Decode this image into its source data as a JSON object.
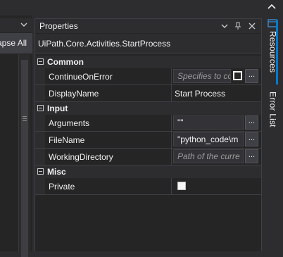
{
  "left_panel": {
    "toolbar_text": "apse All"
  },
  "properties": {
    "title": "Properties",
    "activity_name": "UiPath.Core.Activities.StartProcess",
    "categories": [
      {
        "name": "Common",
        "properties": [
          {
            "name": "ContinueOnError",
            "placeholder": "Specifies to co",
            "has_square": true,
            "has_ellipsis": true
          },
          {
            "name": "DisplayName",
            "value": "Start Process"
          }
        ]
      },
      {
        "name": "Input",
        "properties": [
          {
            "name": "Arguments",
            "value": "\"\"",
            "has_ellipsis": true
          },
          {
            "name": "FileName",
            "value": "\"python_code\\m",
            "has_ellipsis": true
          },
          {
            "name": "WorkingDirectory",
            "placeholder": "Path of the curre",
            "has_ellipsis": true
          }
        ]
      },
      {
        "name": "Misc",
        "properties": [
          {
            "name": "Private",
            "checked": false
          }
        ]
      }
    ],
    "ellipsis_label": "..."
  },
  "right_dock": {
    "tabs": [
      {
        "label": "Resources",
        "active": true
      },
      {
        "label": "Error List",
        "active": false
      }
    ]
  },
  "icons": {
    "topbar": "chevron-up-icon",
    "dropdown": "chevron-down-icon",
    "pin": "pin-icon",
    "close": "close-icon",
    "resources": "resources-icon"
  },
  "colors": {
    "accent": "#007acc",
    "background": "#252526",
    "header": "#2d2d30"
  }
}
